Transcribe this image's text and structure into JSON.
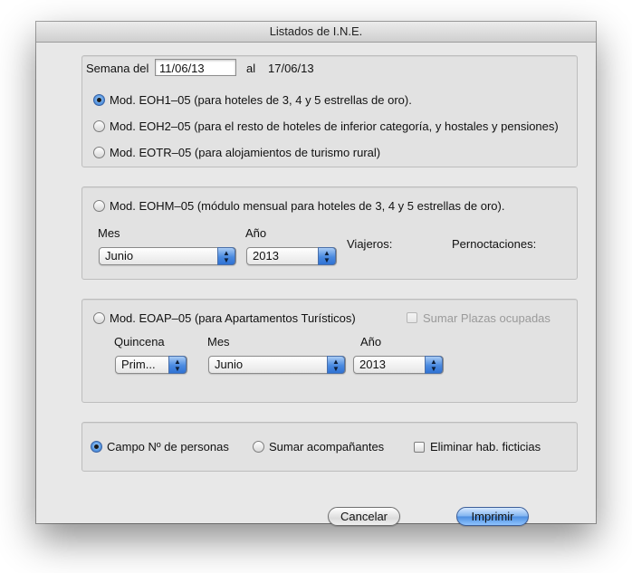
{
  "window": {
    "title": "Listados de I.N.E."
  },
  "week": {
    "label_from": "Semana del",
    "from_value": "11/06/13",
    "label_to": "al",
    "to_value": "17/06/13"
  },
  "weekly_options": [
    {
      "label": "Mod. EOH1–05 (para hoteles de 3, 4 y 5 estrellas de oro).",
      "selected": true
    },
    {
      "label": "Mod. EOH2–05 (para el resto de hoteles de inferior categoría, y hostales y pensiones)",
      "selected": false
    },
    {
      "label": "Mod. EOTR–05 (para alojamientos de turismo rural)",
      "selected": false
    }
  ],
  "monthly": {
    "radio_label": "Mod. EOHM–05 (módulo mensual para hoteles de 3, 4 y 5 estrellas de oro).",
    "mes_label": "Mes",
    "mes_value": "Junio",
    "anio_label": "Año",
    "anio_value": "2013",
    "viajeros_label": "Viajeros:",
    "pernoctaciones_label": "Pernoctaciones:"
  },
  "apartments": {
    "radio_label": "Mod. EOAP–05 (para Apartamentos Turísticos)",
    "sumar_plazas_label": "Sumar Plazas ocupadas",
    "quincena_label": "Quincena",
    "quincena_value": "Prim...",
    "mes_label": "Mes",
    "mes_value": "Junio",
    "anio_label": "Año",
    "anio_value": "2013"
  },
  "options": {
    "campo_personas": "Campo Nº de personas",
    "sumar_acompanantes": "Sumar acompañantes",
    "eliminar_hab": "Eliminar hab. ficticias"
  },
  "buttons": {
    "cancel": "Cancelar",
    "print": "Imprimir"
  }
}
